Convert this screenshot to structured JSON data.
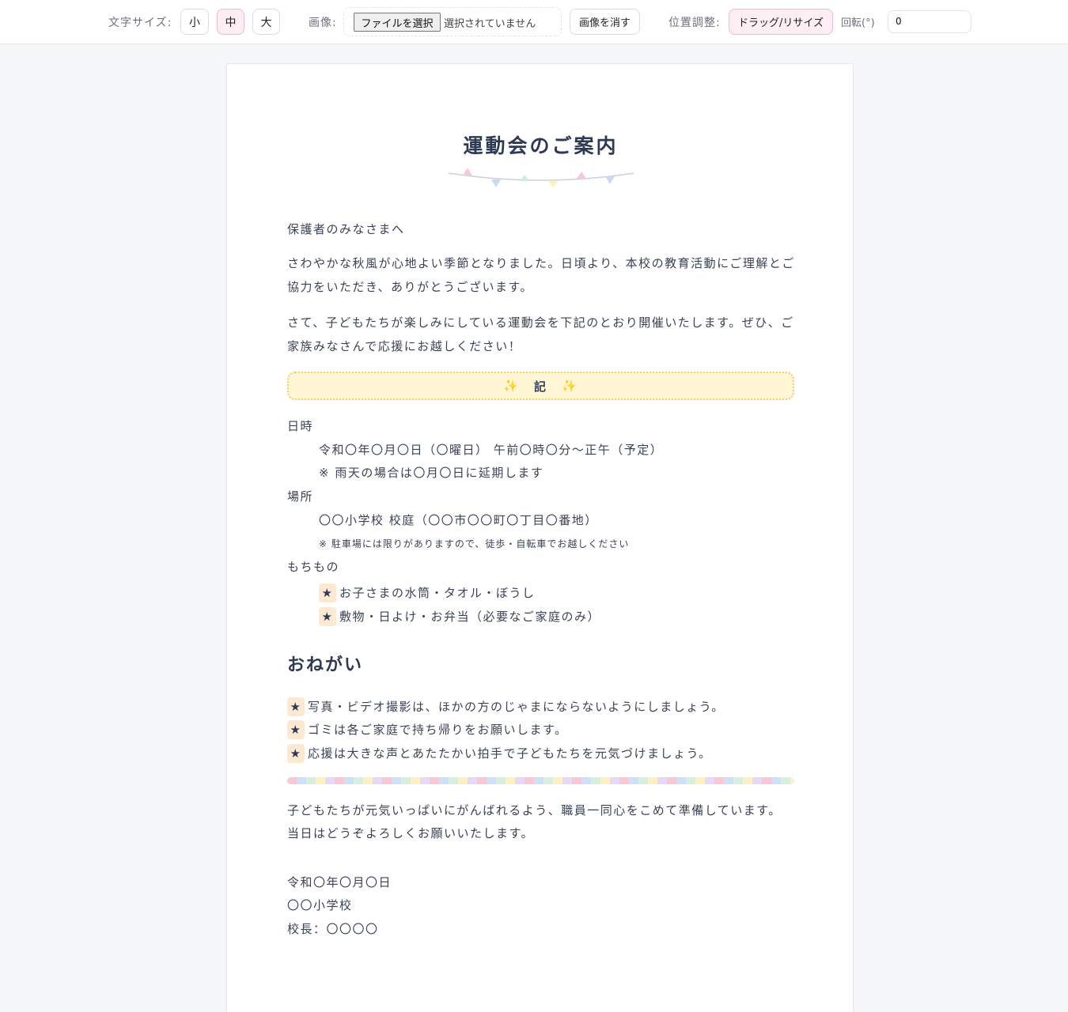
{
  "toolbar": {
    "font_size_label": "文字サイズ:",
    "size_small": "小",
    "size_medium": "中",
    "size_large": "大",
    "image_label": "画像:",
    "file_button": "ファイルを選択",
    "file_status": "選択されていません",
    "clear_image": "画像を消す",
    "position_label": "位置調整:",
    "drag_resize": "ドラッグ/リサイズ",
    "rotation_label": "回転(°)",
    "rotation_value": "0"
  },
  "doc": {
    "title": "運動会のご案内",
    "greeting": "保護者のみなさまへ",
    "para1": "さわやかな秋風が心地よい季節となりました。日頃より、本校の教育活動にご理解とご協力をいただき、ありがとうございます。",
    "para2": "さて、子どもたちが楽しみにしている運動会を下記のとおり開催いたします。ぜひ、ご家族みなさんで応援にお越しください！",
    "ki": "記",
    "sparkle": "✨",
    "datetime_label": "日時",
    "datetime_value": "令和〇年〇月〇日（〇曜日） 午前〇時〇分〜正午（予定）",
    "datetime_note": "※ 雨天の場合は〇月〇日に延期します",
    "place_label": "場所",
    "place_value": "〇〇小学校 校庭（〇〇市〇〇町〇丁目〇番地）",
    "place_note": "※ 駐車場には限りがありますので、徒歩・自転車でお越しください",
    "items_label": "もちもの",
    "items": [
      "お子さまの水筒・タオル・ぼうし",
      "敷物・日よけ・お弁当（必要なご家庭のみ）"
    ],
    "request_heading": "おねがい",
    "requests": [
      "写真・ビデオ撮影は、ほかの方のじゃまにならないようにしましょう。",
      "ゴミは各ご家庭で持ち帰りをお願いします。",
      "応援は大きな声とあたたかい拍手で子どもたちを元気づけましょう。"
    ],
    "closing1": "子どもたちが元気いっぱいにがんばれるよう、職員一同心をこめて準備しています。",
    "closing2": "当日はどうぞよろしくお願いいたします。",
    "date": "令和〇年〇月〇日",
    "school": "〇〇小学校",
    "principal": "校長：〇〇〇〇",
    "star": "★"
  },
  "colors": {
    "accent_pink": "#fdeef3",
    "ki_background": "#fff6d6",
    "star_background": "#fde9d2",
    "text": "#3a4256"
  }
}
